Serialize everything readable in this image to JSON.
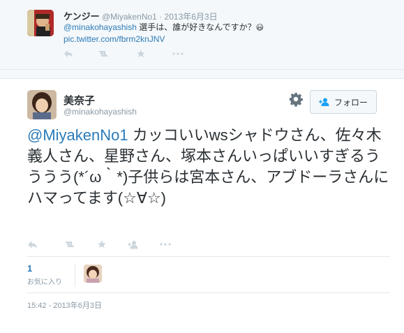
{
  "parent_tweet": {
    "name": "ケンジー",
    "handle": "@MiyakenNo1",
    "separator": "·",
    "date": "2013年6月3日",
    "mention": "@minakohayashish",
    "text": " 選手は、誰が好きなんですか？",
    "emoji": "😃",
    "link": "pic.twitter.com/fbrm2knJNV"
  },
  "main_tweet": {
    "name": "美奈子",
    "handle": "@minakohayashish",
    "follow_label": "フォロー",
    "mention": "@MiyakenNo1",
    "text": " カッコいいwsシャドウさん、佐々木義人さん、星野さん、塚本さんいっぱいいすぎるうううう(*´ω｀*)子供らは宮本さん、アブドーラさんにハマってます(☆∀☆)",
    "favorites_count": "1",
    "favorites_label": "お気に入り",
    "timestamp": "15:42 - 2013年6月3日"
  },
  "icons": [
    "reply-icon",
    "retweet-icon",
    "favorite-icon",
    "follow-icon",
    "more-icon",
    "gear-icon"
  ],
  "colors": {
    "link": "#2b7bb9",
    "muted": "#8899a6",
    "text": "#292f33",
    "border": "#e1e8ed"
  }
}
